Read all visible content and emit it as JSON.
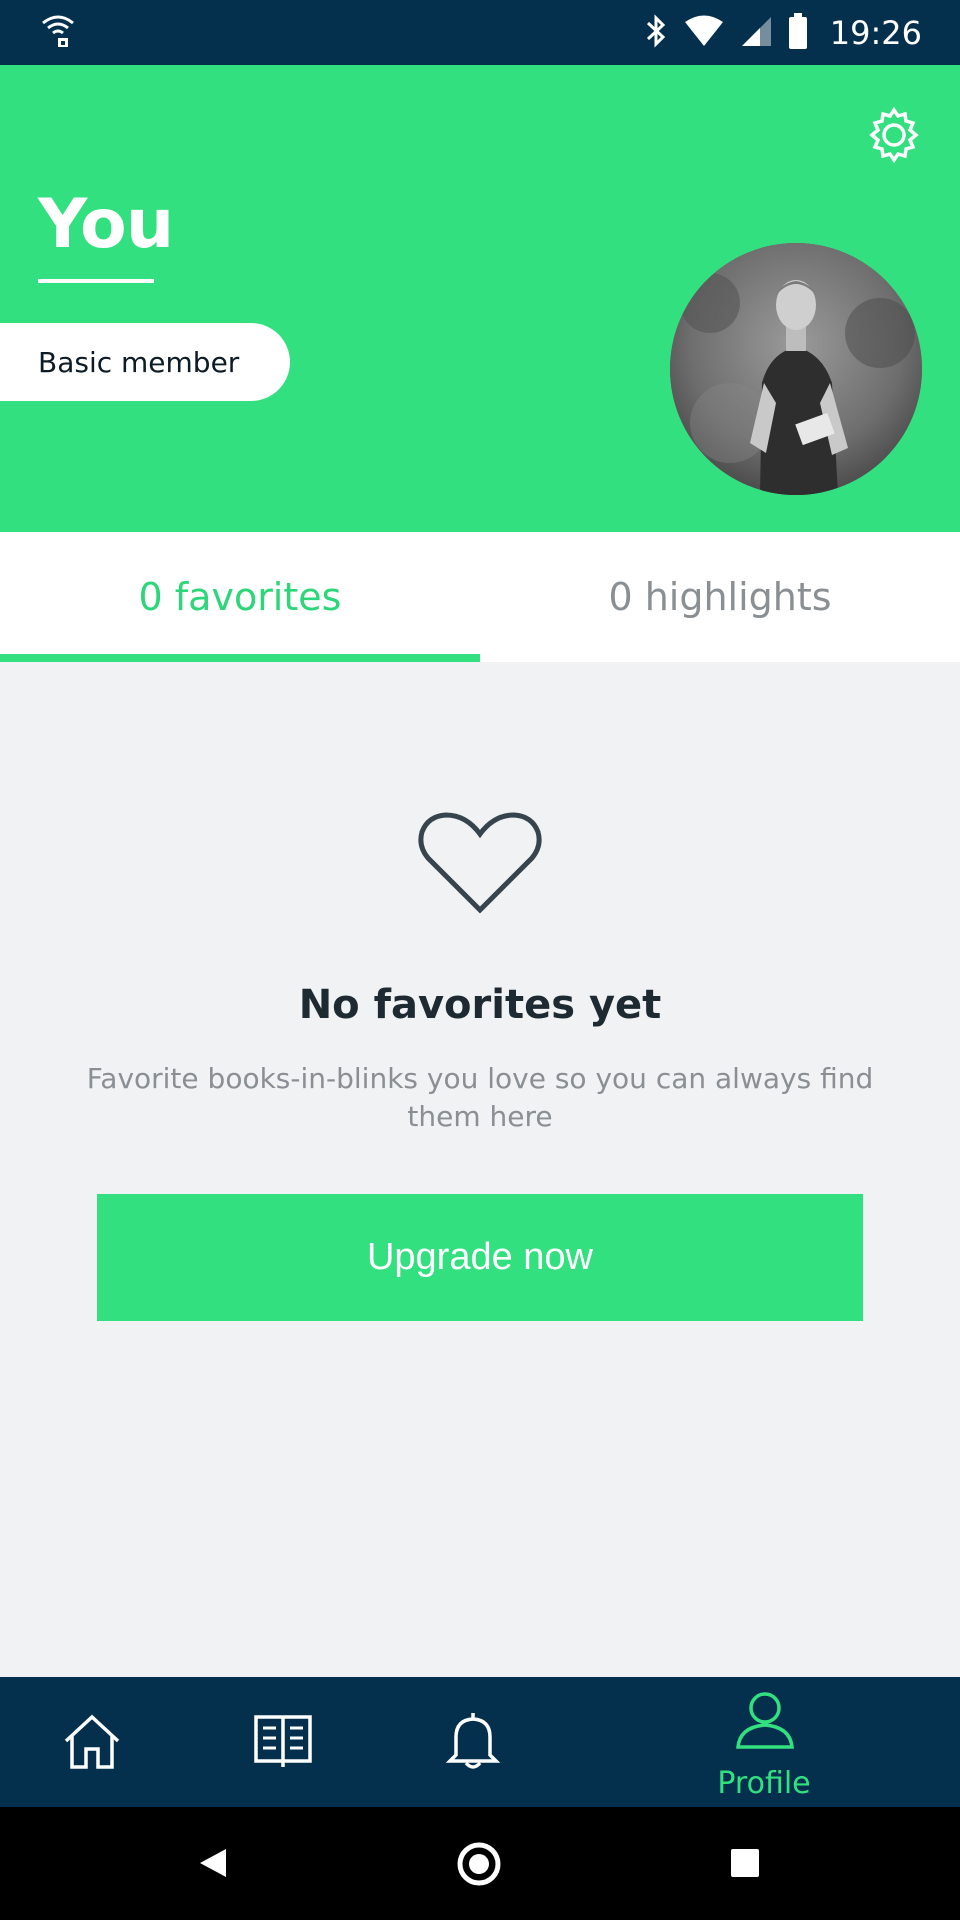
{
  "status_bar": {
    "time": "19:26"
  },
  "header": {
    "title": "You",
    "membership": "Basic member"
  },
  "tabs": [
    {
      "label": "0 favorites",
      "active": true
    },
    {
      "label": "0 highlights",
      "active": false
    }
  ],
  "empty_state": {
    "title": "No favorites yet",
    "description": "Favorite books-in-blinks you love so you can always find them here",
    "button_label": "Upgrade now"
  },
  "bottom_nav": {
    "items": [
      {
        "icon": "home-icon"
      },
      {
        "icon": "library-icon"
      },
      {
        "icon": "bell-icon"
      },
      {
        "icon": "profile-icon",
        "label": "Profile",
        "active": true
      }
    ]
  },
  "colors": {
    "brand_green": "#32e080",
    "navy": "#05304d"
  }
}
